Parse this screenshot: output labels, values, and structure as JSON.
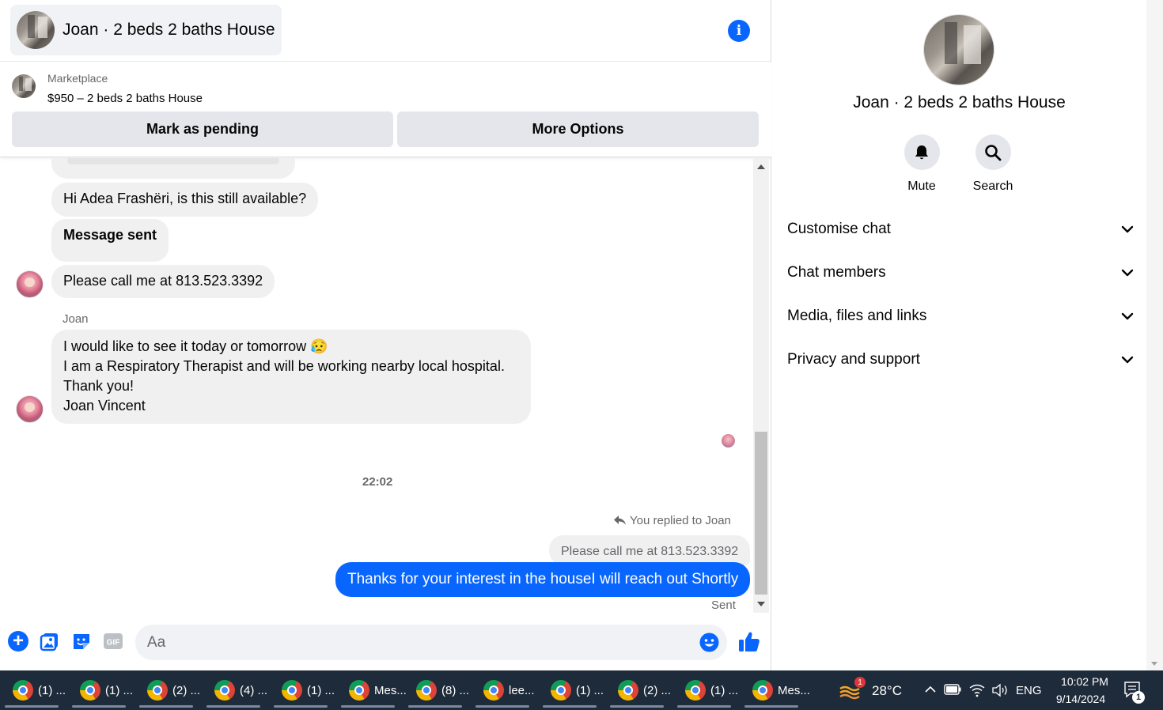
{
  "chat": {
    "title": "Joan · 2 beds 2 baths House",
    "listing": {
      "source": "Marketplace",
      "price_title": "$950 – 2 beds 2 baths House",
      "mark_pending_label": "Mark as pending",
      "more_options_label": "More Options"
    },
    "messages": {
      "availability": "Hi Adea Frashëri, is this still available?",
      "sent_status": "Message sent",
      "call_request": "Please call me at 813.523.3392",
      "sender_name": "Joan",
      "long_message_lines": [
        "I would like to see it today or tomorrow 😥",
        "I am a Respiratory Therapist and will be working nearby local hospital.",
        "Thank you!",
        "Joan Vincent"
      ],
      "timestamp": "22:02",
      "reply_context": "You replied to Joan",
      "quoted_text": "Please call me at 813.523.3392",
      "outgoing": "Thanks for your interest in the houseI will reach out Shortly",
      "delivery_status": "Sent"
    },
    "composer": {
      "placeholder": "Aa",
      "accent_color": "#0866ff"
    }
  },
  "info_panel": {
    "title": "Joan · 2 beds 2 baths House",
    "actions": {
      "mute_label": "Mute",
      "search_label": "Search"
    },
    "sections": [
      "Customise chat",
      "Chat members",
      "Media, files and links",
      "Privacy and support"
    ]
  },
  "taskbar": {
    "items": [
      {
        "label": "(1) ..."
      },
      {
        "label": "(1) ..."
      },
      {
        "label": "(2) ..."
      },
      {
        "label": "(4) ..."
      },
      {
        "label": "(1) ..."
      },
      {
        "label": "Mes..."
      },
      {
        "label": "(8) ..."
      },
      {
        "label": "lee..."
      },
      {
        "label": "(1) ..."
      },
      {
        "label": "(2) ..."
      },
      {
        "label": "(1) ..."
      },
      {
        "label": "Mes..."
      }
    ],
    "weather_badge": "1",
    "temperature": "28°C",
    "language": "ENG",
    "time": "10:02 PM",
    "date": "9/14/2024",
    "notification_count": "1"
  }
}
